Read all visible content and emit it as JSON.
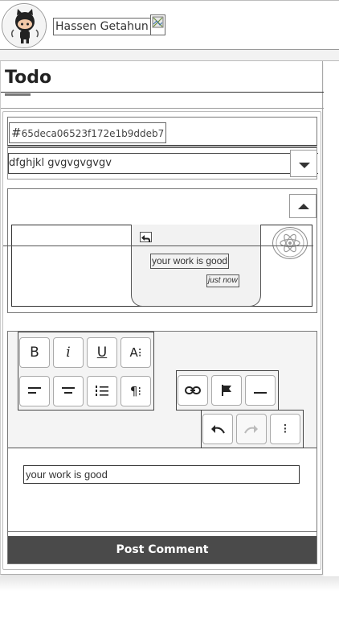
{
  "header": {
    "user_name": "Hassen Getahun",
    "avatar_icon": "github-octocat-icon",
    "broken_image_icon": "broken-image-icon"
  },
  "page": {
    "title": "Todo"
  },
  "todo": {
    "id_prefix": "#",
    "id": "65deca06523f172e1b9ddeb7",
    "selected_value": "dfghjkl gvgvgvgvgv"
  },
  "messages": {
    "items": [
      {
        "text": "your work is good",
        "time": "just now"
      }
    ],
    "avatar_icon": "react-atom-icon",
    "reply_icon": "reply-arrow-icon"
  },
  "editor": {
    "toolbar": {
      "bold": "B",
      "italic": "i",
      "underline": "U",
      "font_size": "A⁝",
      "paragraph": "¶⁝",
      "more": "⁝"
    },
    "input_value": "your work is good",
    "post_label": "Post Comment"
  },
  "colors": {
    "post_button_bg": "#4a4a4a",
    "toolbar_bg": "#f4f4f4",
    "bubble_bg": "#f2f2f2"
  }
}
